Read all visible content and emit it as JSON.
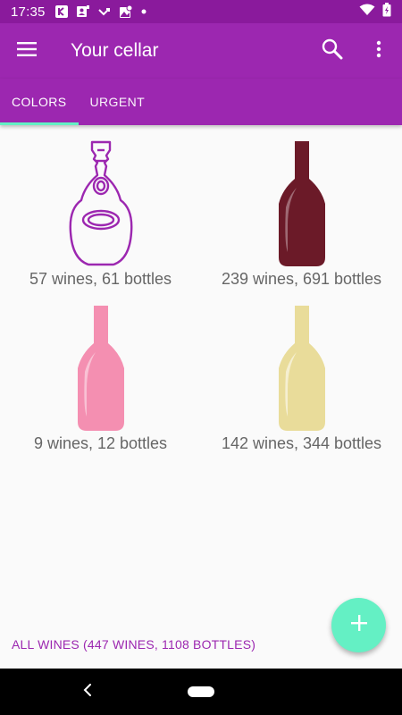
{
  "status_bar": {
    "time": "17:35",
    "notification_icons": [
      "kindle-icon",
      "account-box-icon",
      "missed-call-icon",
      "location-image-icon",
      "dot-icon"
    ],
    "system_icons": [
      "wifi-icon",
      "battery-icon"
    ]
  },
  "app_bar": {
    "title": "Your cellar",
    "icons": [
      "menu-icon",
      "search-icon",
      "more-vert-icon"
    ]
  },
  "tabs": [
    {
      "label": "COLORS",
      "active": true
    },
    {
      "label": "URGENT",
      "active": false
    }
  ],
  "wine_colors": [
    {
      "label": "57 wines, 61 bottles",
      "icon": "outline-bottle-icon",
      "color": "#9c27b0"
    },
    {
      "label": "239 wines, 691 bottles",
      "icon": "red-wine-bottle-icon",
      "color": "#6b1a28"
    },
    {
      "label": "9 wines, 12 bottles",
      "icon": "rose-wine-bottle-icon",
      "color": "#f48fb1"
    },
    {
      "label": "142 wines, 344 bottles",
      "icon": "white-wine-bottle-icon",
      "color": "#e9dc9a"
    }
  ],
  "footer": {
    "all_wines_label": "ALL WINES (447 WINES, 1108 BOTTLES)"
  },
  "fab": {
    "icon": "plus-icon"
  },
  "nav_bar": {
    "icons": [
      "back-icon",
      "home-pill-icon"
    ]
  },
  "colors": {
    "status_bar": "#8a1a9c",
    "primary": "#9c27b0",
    "accent": "#64f0c4",
    "background": "#fafafa",
    "text_secondary": "#666666"
  }
}
